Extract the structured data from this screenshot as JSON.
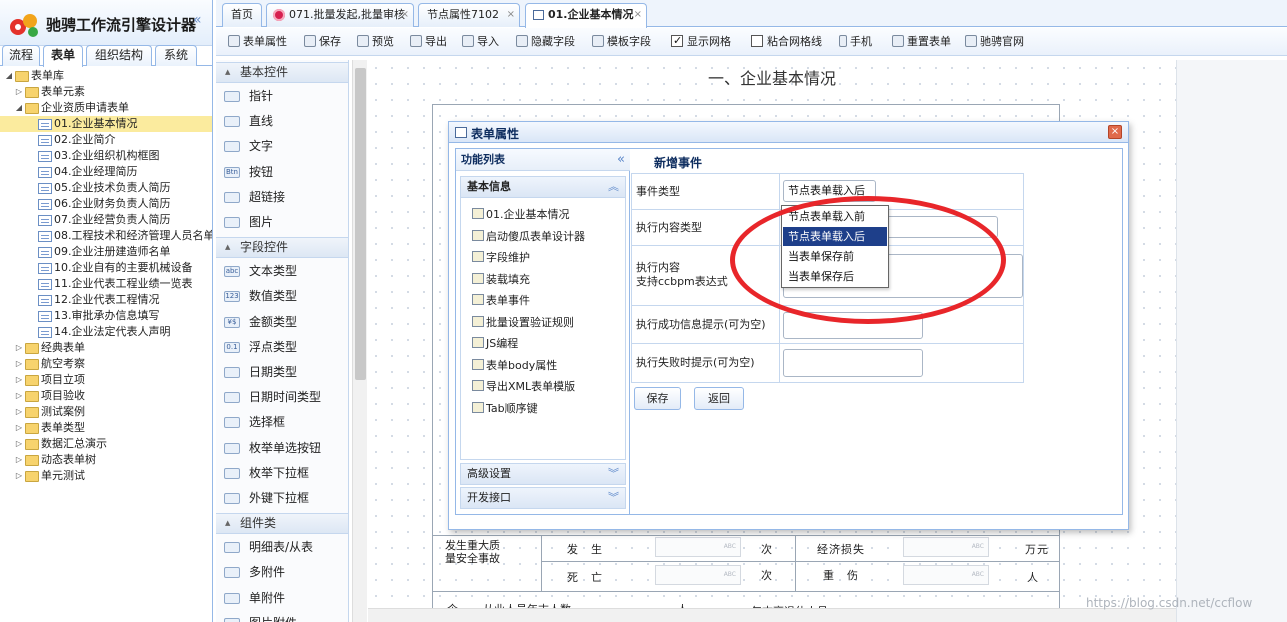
{
  "app": {
    "title": "驰骋工作流引擎设计器",
    "collapse_icon": "double-chevron-left-icon"
  },
  "left_tabs": [
    "流程",
    "表单",
    "组织结构",
    "系统"
  ],
  "tree": [
    {
      "label": "表单库",
      "type": "folder",
      "level": 0,
      "expanded": true
    },
    {
      "label": "表单元素",
      "type": "folder",
      "level": 1,
      "expanded": false
    },
    {
      "label": "企业资质申请表单",
      "type": "folder",
      "level": 1,
      "expanded": true
    },
    {
      "label": "01.企业基本情况",
      "type": "file",
      "level": 2,
      "selected": true
    },
    {
      "label": "02.企业简介",
      "type": "file",
      "level": 2
    },
    {
      "label": "03.企业组织机构框图",
      "type": "file",
      "level": 2
    },
    {
      "label": "04.企业经理简历",
      "type": "file",
      "level": 2
    },
    {
      "label": "05.企业技术负责人简历",
      "type": "file",
      "level": 2
    },
    {
      "label": "06.企业财务负责人简历",
      "type": "file",
      "level": 2
    },
    {
      "label": "07.企业经营负责人简历",
      "type": "file",
      "level": 2
    },
    {
      "label": "08.工程技术和经济管理人员名单",
      "type": "file",
      "level": 2
    },
    {
      "label": "09.企业注册建造师名单",
      "type": "file",
      "level": 2
    },
    {
      "label": "10.企业自有的主要机械设备",
      "type": "file",
      "level": 2
    },
    {
      "label": "11.企业代表工程业绩一览表",
      "type": "file",
      "level": 2
    },
    {
      "label": "12.企业代表工程情况",
      "type": "file",
      "level": 2
    },
    {
      "label": "13.审批承办信息填写",
      "type": "file",
      "level": 2
    },
    {
      "label": "14.企业法定代表人声明",
      "type": "file",
      "level": 2
    },
    {
      "label": "经典表单",
      "type": "folder",
      "level": 1
    },
    {
      "label": "航空考察",
      "type": "folder",
      "level": 1
    },
    {
      "label": "项目立项",
      "type": "folder",
      "level": 1
    },
    {
      "label": "项目验收",
      "type": "folder",
      "level": 1
    },
    {
      "label": "测试案例",
      "type": "folder",
      "level": 1
    },
    {
      "label": "表单类型",
      "type": "folder",
      "level": 1
    },
    {
      "label": "数据汇总演示",
      "type": "folder",
      "level": 1
    },
    {
      "label": "动态表单树",
      "type": "folder",
      "level": 1
    },
    {
      "label": "单元测试",
      "type": "folder",
      "level": 1
    }
  ],
  "tabs": [
    {
      "label": "首页",
      "closable": false
    },
    {
      "label": "071.批量发起,批量审核",
      "closable": true,
      "icon": "flower-icon"
    },
    {
      "label": "节点属性7102",
      "closable": true
    },
    {
      "label": "01.企业基本情况",
      "closable": true,
      "active": true,
      "icon": "form-icon"
    }
  ],
  "toolbar": [
    {
      "label": "表单属性",
      "icon": "form-properties-icon"
    },
    {
      "label": "保存",
      "icon": "save-icon"
    },
    {
      "label": "预览",
      "icon": "preview-icon"
    },
    {
      "label": "导出",
      "icon": "export-icon"
    },
    {
      "label": "导入",
      "icon": "import-icon"
    },
    {
      "label": "隐藏字段",
      "icon": "hidden-field-icon"
    },
    {
      "label": "模板字段",
      "icon": "template-field-icon"
    },
    {
      "label": "显示网格",
      "checkbox": true,
      "checked": true
    },
    {
      "label": "粘合网格线",
      "checkbox": true,
      "checked": false
    },
    {
      "label": "手机",
      "icon": "mobile-icon"
    },
    {
      "label": "重置表单",
      "icon": "reset-icon"
    },
    {
      "label": "驰骋官网",
      "icon": "home-icon"
    }
  ],
  "palette": {
    "sections": [
      {
        "title": "基本控件",
        "items": [
          {
            "label": "指针",
            "icon": "pointer-icon"
          },
          {
            "label": "直线",
            "icon": "line-icon"
          },
          {
            "label": "文字",
            "icon": "text-icon"
          },
          {
            "label": "按钮",
            "icon": "button-icon",
            "glyph": "Btn"
          },
          {
            "label": "超链接",
            "icon": "link-icon"
          },
          {
            "label": "图片",
            "icon": "image-icon"
          }
        ]
      },
      {
        "title": "字段控件",
        "items": [
          {
            "label": "文本类型",
            "icon": "text-field-icon",
            "glyph": "abc"
          },
          {
            "label": "数值类型",
            "icon": "number-field-icon",
            "glyph": "123"
          },
          {
            "label": "金额类型",
            "icon": "money-field-icon",
            "glyph": "¥$"
          },
          {
            "label": "浮点类型",
            "icon": "float-field-icon",
            "glyph": "0.1"
          },
          {
            "label": "日期类型",
            "icon": "calendar-icon"
          },
          {
            "label": "日期时间类型",
            "icon": "clock-icon"
          },
          {
            "label": "选择框",
            "icon": "checkbox-icon"
          },
          {
            "label": "枚举单选按钮",
            "icon": "radio-icon"
          },
          {
            "label": "枚举下拉框",
            "icon": "dropdown-icon"
          },
          {
            "label": "外键下拉框",
            "icon": "foreign-key-icon"
          }
        ]
      },
      {
        "title": "组件类",
        "items": [
          {
            "label": "明细表/从表",
            "icon": "detail-table-icon"
          },
          {
            "label": "多附件",
            "icon": "multi-attachment-icon"
          },
          {
            "label": "单附件",
            "icon": "single-attachment-icon"
          },
          {
            "label": "图片附件",
            "icon": "image-attachment-icon"
          }
        ]
      }
    ]
  },
  "canvas": {
    "heading": "一、企业基本情况",
    "row1": {
      "label": "发生重大质量安全事故",
      "c1": "发　生",
      "c2": "次",
      "c3": "经济损失",
      "c4": "万元"
    },
    "row2": {
      "c1": "死　亡",
      "c2": "次",
      "c3": "重　伤",
      "c4": "人"
    },
    "row3": {
      "c0": "企",
      "c1": "从业人员年末人数",
      "c2": "人",
      "c3": "年末离退休人员"
    },
    "placeholder": "ABC"
  },
  "dialog": {
    "title": "表单属性",
    "function_list_title": "功能列表",
    "basic_info": "基本信息",
    "basic_items": [
      {
        "label": "01.企业基本情况",
        "icon": "home-icon"
      },
      {
        "label": "启动傻瓜表单设计器",
        "icon": "excel-icon"
      },
      {
        "label": "字段维护",
        "icon": "field-icon"
      },
      {
        "label": "装载填充",
        "icon": "load-icon"
      },
      {
        "label": "表单事件",
        "icon": "lightning-icon"
      },
      {
        "label": "批量设置验证规则",
        "icon": "validate-icon"
      },
      {
        "label": "JS编程",
        "icon": "js-icon"
      },
      {
        "label": "表单body属性",
        "icon": "body-icon"
      },
      {
        "label": "导出XML表单模版",
        "icon": "export-xml-icon"
      },
      {
        "label": "Tab顺序键",
        "icon": "gear-icon"
      }
    ],
    "advanced": "高级设置",
    "dev_interface": "开发接口",
    "content_title": "新增事件",
    "fields": [
      {
        "label": "事件类型",
        "value": "节点表单载入后"
      },
      {
        "label": "执行内容类型",
        "value": ""
      },
      {
        "label": "执行内容\n支持ccbpm表达式",
        "value": ""
      },
      {
        "label": "执行成功信息提示(可为空)",
        "value": ""
      },
      {
        "label": "执行失败时提示(可为空)",
        "value": ""
      }
    ],
    "save_button": "保存",
    "back_button": "返回",
    "dropdown_options": [
      "节点表单载入前",
      "节点表单载入后",
      "当表单保存前",
      "当表单保存后"
    ],
    "dropdown_highlight": 1
  },
  "watermark": "https://blog.csdn.net/ccflow",
  "colors": {
    "accent": "#95b8e7",
    "highlight": "#1e3f8a",
    "annotation": "#e8262a",
    "selected": "#fbeb9e"
  }
}
